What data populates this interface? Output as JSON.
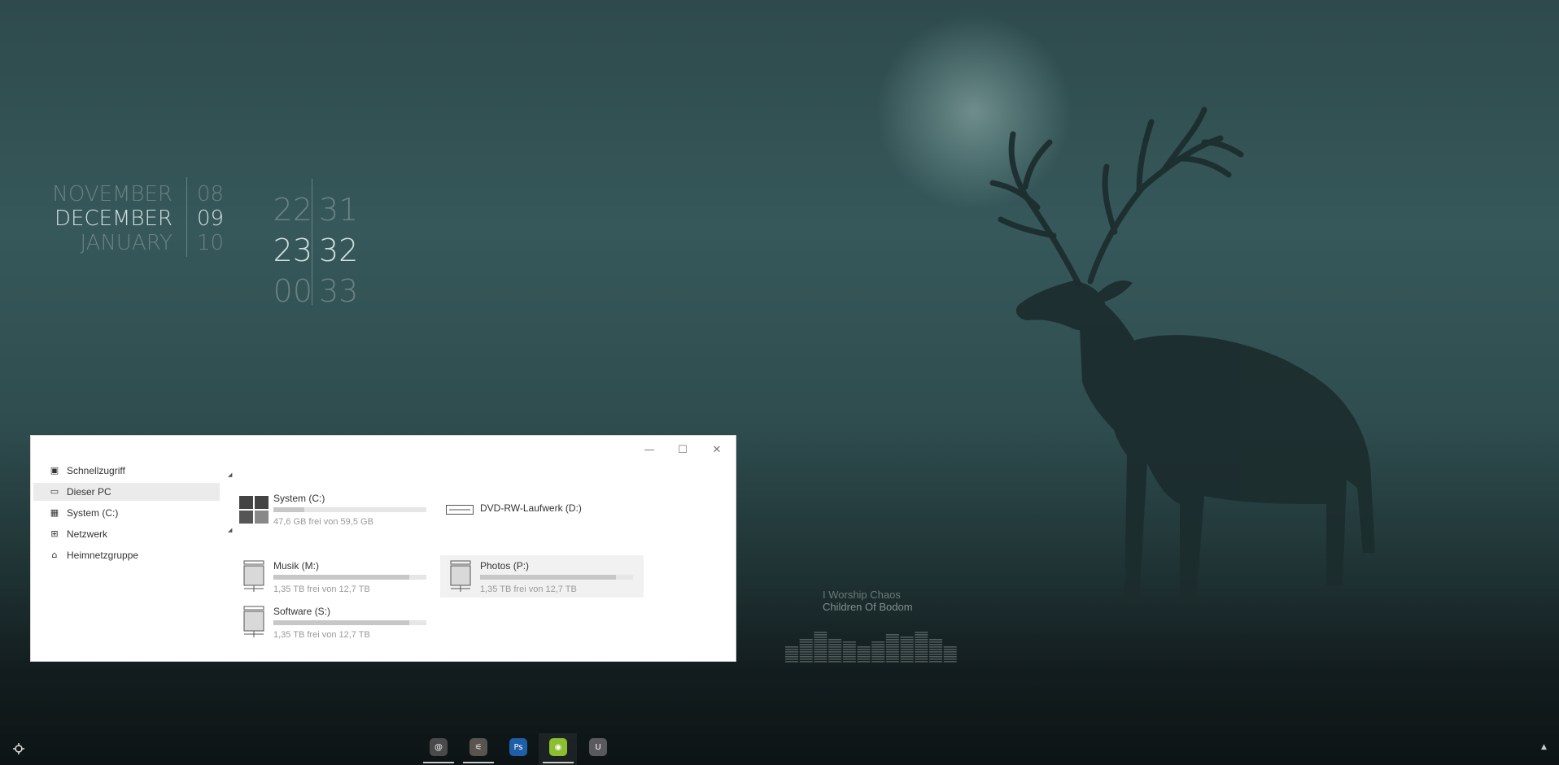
{
  "date_widget": {
    "months": [
      "NOVEMBER",
      "DECEMBER",
      "JANUARY"
    ],
    "days": [
      "08",
      "09",
      "10"
    ]
  },
  "clock": {
    "hours": [
      "22",
      "23",
      "00"
    ],
    "minutes": [
      "31",
      "32",
      "33"
    ]
  },
  "explorer": {
    "window_controls": {
      "minimize": "—",
      "maximize": "☐",
      "close": "✕"
    },
    "nav": [
      {
        "label": "Schnellzugriff",
        "icon": "quick-access-icon"
      },
      {
        "label": "Dieser PC",
        "icon": "this-pc-icon",
        "selected": true
      },
      {
        "label": "System (C:)",
        "icon": "windows-drive-icon"
      },
      {
        "label": "Netzwerk",
        "icon": "network-icon"
      },
      {
        "label": "Heimnetzgruppe",
        "icon": "homegroup-icon"
      }
    ],
    "drives": [
      {
        "name": "System (C:)",
        "free": "47,6 GB frei von 59,5 GB",
        "used_fraction": 0.2
      },
      {
        "name": "DVD-RW-Laufwerk (D:)"
      },
      {
        "name": "Musik (M:)",
        "free": "1,35 TB frei von 12,7 TB",
        "used_fraction": 0.89
      },
      {
        "name": "Photos (P:)",
        "free": "1,35 TB frei von 12,7 TB",
        "used_fraction": 0.89
      },
      {
        "name": "Software (S:)",
        "free": "1,35 TB frei von 12,7 TB",
        "used_fraction": 0.89
      }
    ]
  },
  "music": {
    "title": "I Worship Chaos",
    "artist": "Children Of Bodom",
    "equalizer_levels": [
      0.45,
      0.7,
      0.85,
      0.7,
      0.6,
      0.5,
      0.6,
      0.8,
      0.75,
      0.85,
      0.7,
      0.5
    ]
  },
  "taskbar": {
    "apps": [
      {
        "name": "mail-app",
        "glyph": "@",
        "color": "#4a4a4a"
      },
      {
        "name": "settings-app",
        "glyph": "⚟",
        "color": "#5a5450"
      },
      {
        "name": "photoshop-app",
        "glyph": "Ps",
        "color": "#1f5fa8"
      },
      {
        "name": "spotify-app",
        "glyph": "◉",
        "color": "#8cbf2f"
      },
      {
        "name": "misc-app",
        "glyph": "U",
        "color": "#5a5a5e"
      }
    ],
    "start_icon": "start-crosshair-icon",
    "tray_icon": "tray-up-arrow-icon"
  },
  "colors": {
    "wallpaper": "#2f4d4f",
    "spotify": "#8cbf2f",
    "photoshop": "#1f5fa8"
  }
}
